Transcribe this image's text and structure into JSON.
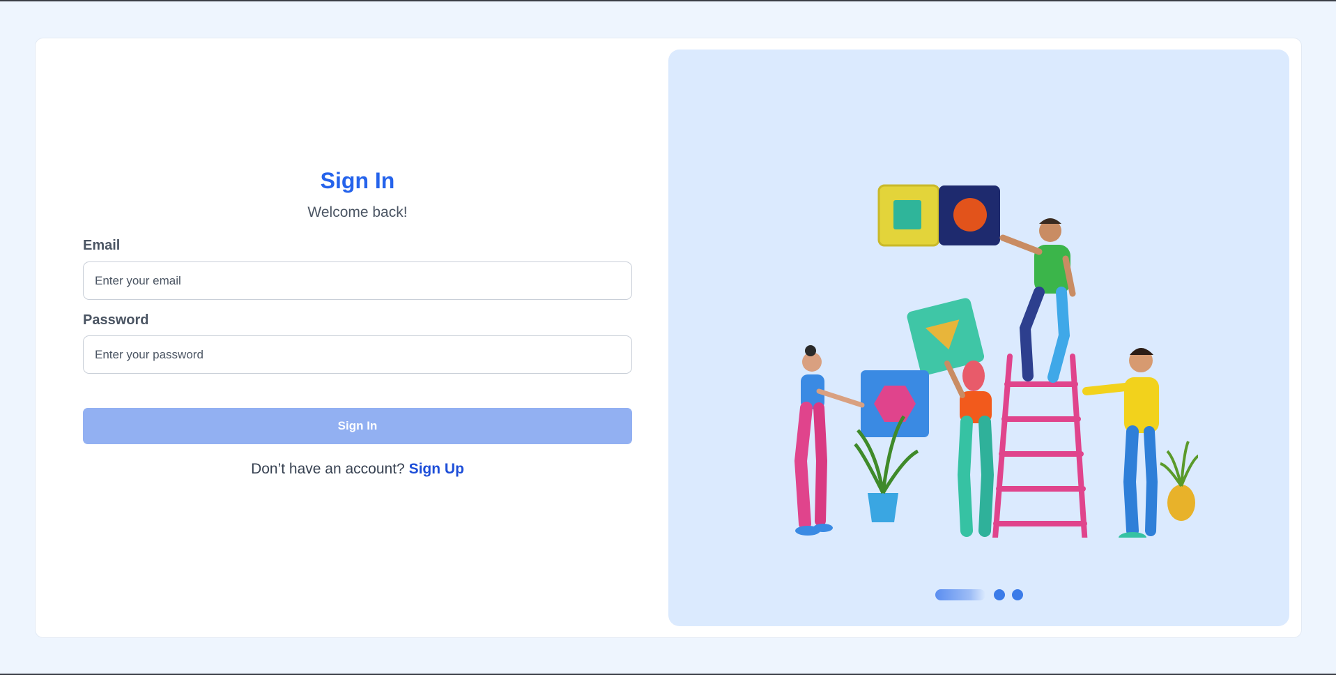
{
  "form": {
    "title": "Sign In",
    "subtitle": "Welcome back!",
    "email": {
      "label": "Email",
      "placeholder": "Enter your email",
      "value": ""
    },
    "password": {
      "label": "Password",
      "placeholder": "Enter your password",
      "value": ""
    },
    "submit_label": "Sign In",
    "signup_prompt": "Don’t have an account?",
    "signup_link": "Sign Up"
  },
  "carousel": {
    "illustration": "team-building-blocks-illustration",
    "slide_count": 3,
    "active_index": 0
  },
  "colors": {
    "accent": "#2563eb",
    "button_disabled": "#92b0f2",
    "panel_bg": "#dbeafe",
    "page_bg": "#eef5fe"
  }
}
